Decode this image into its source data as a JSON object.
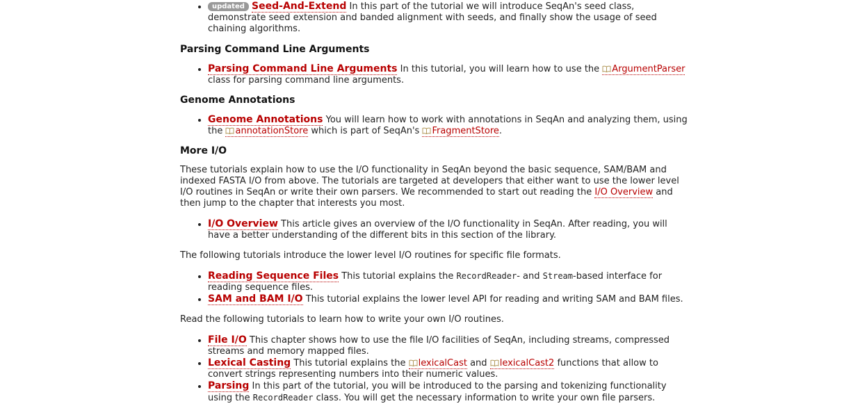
{
  "seed": {
    "badge": "updated",
    "title": "Seed-And-Extend",
    "desc": "In this part of the tutorial we will introduce SeqAn's seed class, demonstrate seed extension and banded alignment with seeds, and finally show the usage of seed chaining algorithms."
  },
  "parsing_section": {
    "heading": "Parsing Command Line Arguments",
    "item_title": "Parsing Command Line Arguments",
    "pre": "In this tutorial, you will learn how to use the",
    "api": "ArgumentParser",
    "post": "class for parsing command line arguments."
  },
  "genome_section": {
    "heading": "Genome Annotations",
    "item_title": "Genome Annotations",
    "pre": "You will learn how to work with annotations in SeqAn and analyzing them, using the",
    "api1": "annotationStore",
    "mid": "which is part of SeqAn's",
    "api2": "FragmentStore",
    "post": "."
  },
  "more_io": {
    "heading": "More I/O",
    "intro_pre": "These tutorials explain how to use the I/O functionality in SeqAn beyond the basic sequence, SAM/BAM and indexed FASTA I/O from above. The tutorials are targeted at developers that either want to use the lower level I/O routines in SeqAn or write their own parsers. We recommended to start out reading the",
    "intro_link": "I/O Overview",
    "intro_post": "and then jump to the chapter that interests you most.",
    "overview_title": "I/O Overview",
    "overview_desc": "This article gives an overview of the I/O functionality in SeqAn. After reading, you will have a better understanding of the different bits in this section of the library.",
    "lower_intro": "The following tutorials introduce the lower level I/O routines for specific file formats.",
    "reading_title": "Reading Sequence Files",
    "reading_pre": "This tutorial explains the",
    "reading_code1": "RecordReader",
    "reading_mid": "- and",
    "reading_code2": "Stream",
    "reading_post": "-based interface for reading sequence files.",
    "sam_title": "SAM and BAM I/O",
    "sam_desc": "This tutorial explains the lower level API for reading and writing SAM and BAM files.",
    "own_intro": "Read the following tutorials to learn how to write your own I/O routines.",
    "fileio_title": "File I/O",
    "fileio_desc": "This chapter shows how to use the file I/O facilities of SeqAn, including streams, compressed streams and memory mapped files.",
    "lexical_title": "Lexical Casting",
    "lexical_pre": "This tutorial explains the",
    "lexical_api1": "lexicalCast",
    "lexical_mid": "and",
    "lexical_api2": "lexicalCast2",
    "lexical_post": "functions that allow to convert strings representing numbers into their numeric values.",
    "parsing_title": "Parsing",
    "parsing_pre": "In this part of the tutorial, you will be introduced to the parsing and tokenizing functionality using the",
    "parsing_code": "RecordReader",
    "parsing_post": "class. You will get the necessary information to write your own file parsers."
  }
}
